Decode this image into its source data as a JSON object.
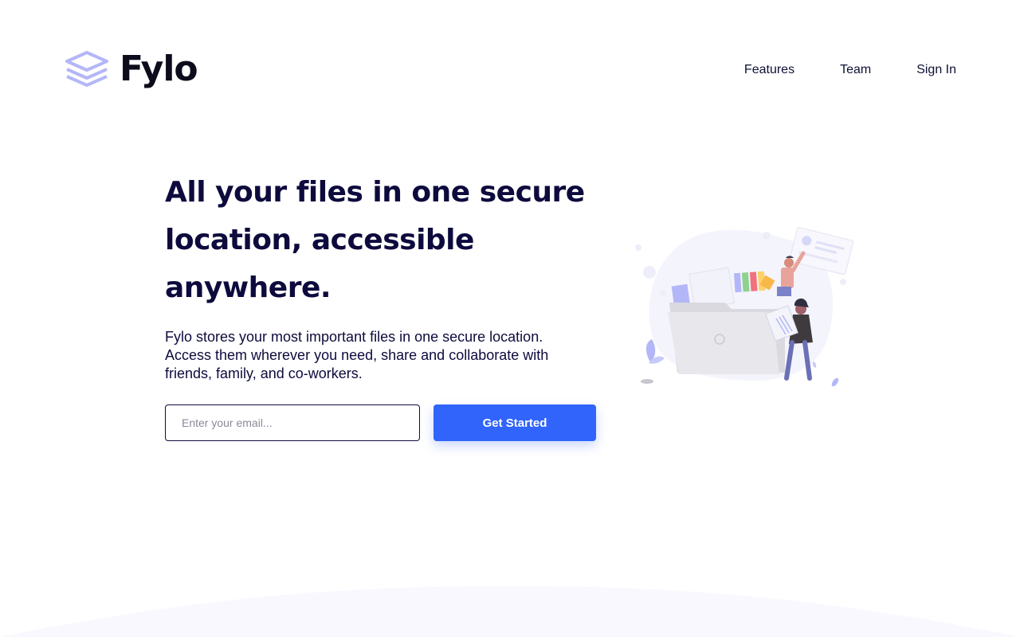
{
  "header": {
    "logo_text": "Fylo",
    "logo_icon": "stacked-layers-icon",
    "nav": [
      {
        "label": "Features"
      },
      {
        "label": "Team"
      },
      {
        "label": "Sign In"
      }
    ]
  },
  "hero": {
    "title": "All your files in one secure location, accessible anywhere.",
    "description": "Fylo stores your most important files in one secure location. Access them wherever you need, share and collaborate with friends, family, and co-workers.",
    "email_placeholder": "Enter your email...",
    "email_value": "",
    "cta_label": "Get Started",
    "illustration_icon": "people-with-files-folder-illustration"
  },
  "colors": {
    "accent": "#3064fb",
    "heading": "#0d0b3d",
    "logo_icon": "#b3b7f7",
    "background_curve": "#f8f8fe"
  }
}
